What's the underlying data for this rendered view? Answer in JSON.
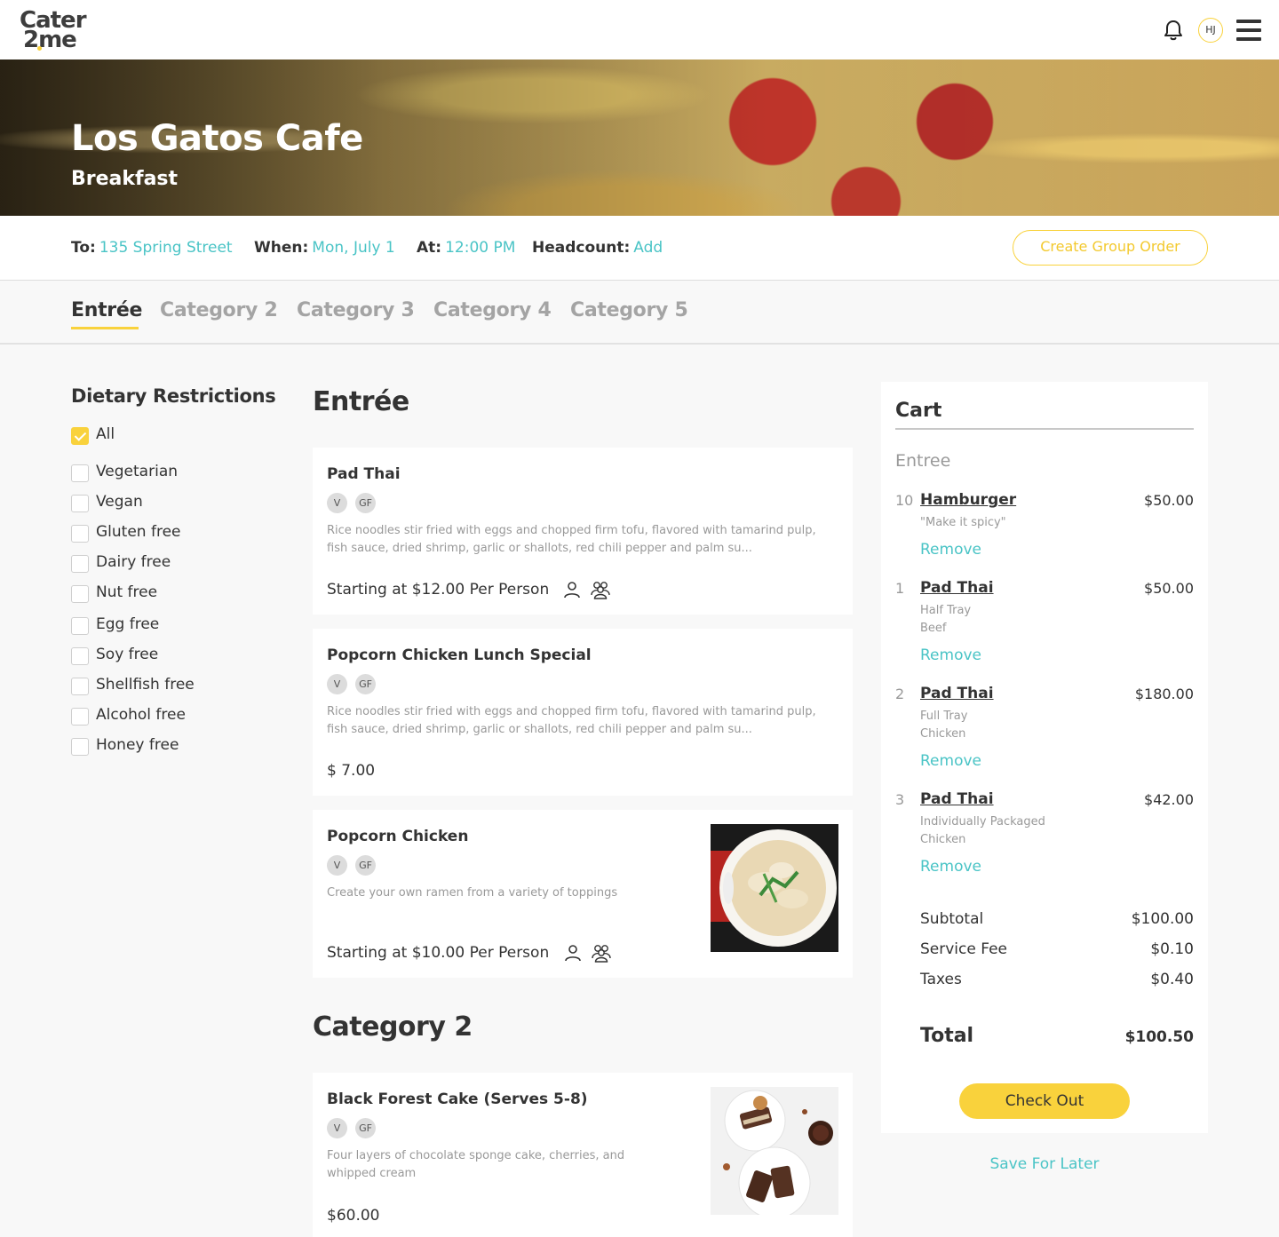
{
  "brand": {
    "logo_line1": "Cater",
    "logo_line2": "2me"
  },
  "header": {
    "avatar_initials": "HJ"
  },
  "hero": {
    "restaurant": "Los Gatos Cafe",
    "meal": "Breakfast"
  },
  "order_info": {
    "to_label": "To:",
    "to_value": "135 Spring Street",
    "when_label": "When:",
    "when_value": "Mon, July 1",
    "at_label": "At:",
    "at_value": "12:00 PM",
    "headcount_label": "Headcount:",
    "headcount_value": "Add",
    "group_order_button": "Create Group Order"
  },
  "tabs": [
    "Entrée",
    "Category 2",
    "Category 3",
    "Category 4",
    "Category 5"
  ],
  "filters": {
    "title": "Dietary Restrictions",
    "items": [
      {
        "label": "All",
        "checked": true
      },
      {
        "label": "Vegetarian",
        "checked": false
      },
      {
        "label": "Vegan",
        "checked": false
      },
      {
        "label": "Gluten free",
        "checked": false
      },
      {
        "label": "Dairy free",
        "checked": false
      },
      {
        "label": "Nut free",
        "checked": false
      },
      {
        "label": "Egg free",
        "checked": false
      },
      {
        "label": "Soy free",
        "checked": false
      },
      {
        "label": "Shellfish free",
        "checked": false
      },
      {
        "label": "Alcohol free",
        "checked": false
      },
      {
        "label": "Honey free",
        "checked": false
      }
    ]
  },
  "menu": {
    "section1_title": "Entrée",
    "section2_title": "Category 2",
    "badges": [
      "V",
      "GF"
    ],
    "items": [
      {
        "name": "Pad Thai",
        "desc": "Rice noodles stir fried with eggs and chopped firm tofu, flavored with tamarind pulp, fish sauce, dried shrimp, garlic or shallots, red chili pepper and palm su...",
        "price": "Starting at $12.00 Per Person"
      },
      {
        "name": "Popcorn Chicken Lunch Special",
        "desc": "Rice noodles stir fried with eggs and chopped firm tofu, flavored with tamarind pulp, fish sauce, dried shrimp, garlic or shallots, red chili pepper and palm su...",
        "price": "$ 7.00"
      },
      {
        "name": "Popcorn Chicken",
        "desc": "Create your own ramen from a variety of toppings",
        "price": "Starting at $10.00 Per Person"
      },
      {
        "name": "Black Forest Cake (Serves 5-8)",
        "desc": "Four layers of chocolate sponge cake, cherries, and whipped cream",
        "price": "$60.00"
      }
    ]
  },
  "cart": {
    "title": "Cart",
    "category": "Entree",
    "remove_label": "Remove",
    "items": [
      {
        "qty": "10",
        "name": "Hamburger",
        "price": "$50.00",
        "notes": [
          "\"Make it spicy\""
        ]
      },
      {
        "qty": "1",
        "name": "Pad Thai",
        "price": "$50.00",
        "notes": [
          "Half Tray",
          "Beef"
        ]
      },
      {
        "qty": "2",
        "name": "Pad Thai",
        "price": "$180.00",
        "notes": [
          "Full Tray",
          "Chicken"
        ]
      },
      {
        "qty": "3",
        "name": "Pad Thai",
        "price": "$42.00",
        "notes": [
          "Individually Packaged",
          "Chicken"
        ]
      }
    ],
    "subtotal_label": "Subtotal",
    "subtotal": "$100.00",
    "service_fee_label": "Service Fee",
    "service_fee": "$0.10",
    "taxes_label": "Taxes",
    "taxes": "$0.40",
    "total_label": "Total",
    "total": "$100.50",
    "checkout_button": "Check Out",
    "save_later": "Save For Later"
  },
  "colors": {
    "accent_yellow": "#f9d23c",
    "link_teal": "#4ac4c6",
    "text_dark": "#333333",
    "muted": "#999999"
  }
}
